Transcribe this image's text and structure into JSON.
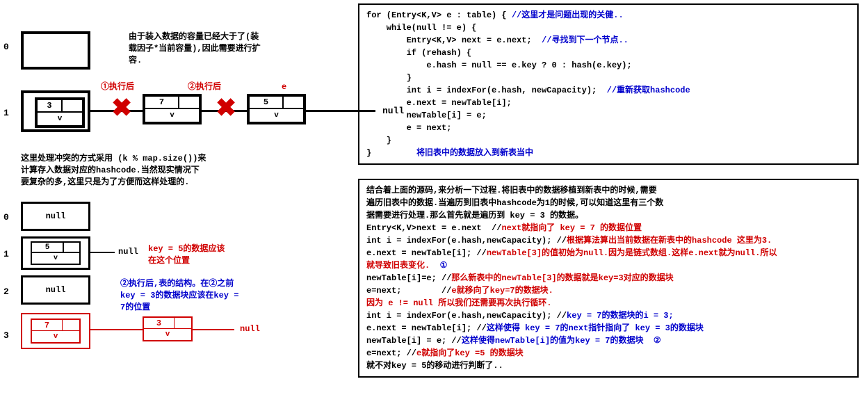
{
  "left": {
    "diagram1": {
      "idx0": "0",
      "idx1": "1",
      "intro": "由于装入数据的容量已经大于了(装\n载因子*当前容量),因此需要进行扩\n容.",
      "lbl_exec1": "①执行后",
      "lbl_exec2": "②执行后",
      "lbl_e": "e",
      "node1_k": "3",
      "node1_v": "v",
      "node2_k": "7",
      "node2_v": "v",
      "node3_k": "5",
      "node3_v": "v",
      "null1": "null",
      "hash_note": "这里处理冲突的方式采用 (k % map.size())来\n计算存入数据对应的hashcode.当然现实情况下\n要复杂的多,这里只是为了方便而这样处理的."
    },
    "diagram2": {
      "idx0": "0",
      "idx1": "1",
      "idx2": "2",
      "idx3": "3",
      "slot0": "null",
      "slot2": "null",
      "n1_k": "5",
      "n1_v": "v",
      "n3_k": "7",
      "n3_v": "v",
      "moved_k": "3",
      "moved_v": "v",
      "null_r1": "null",
      "null_r2": "null",
      "note_r1": "key = 5的数据应该\n在这个位置",
      "note_b": "②执行后,表的结构。在②之前\nkey = 3的数据块应该在key = \n7的位置"
    }
  },
  "code": {
    "l1a": "for (Entry<K,V> e : table) { ",
    "l1b": "//这里才是问题出现的关健..",
    "l2": "    while(null != e) {",
    "l3a": "        Entry<K,V> next = e.next;  ",
    "l3b": "//寻找到下一个节点..",
    "l4": "        if (rehash) {",
    "l5": "            e.hash = null == e.key ? 0 : hash(e.key);",
    "l6": "        }",
    "l7a": "        int i = indexFor(e.hash, newCapacity);  ",
    "l7b": "//重新获取hashcode",
    "l8": "        e.next = newTable[i];",
    "l9": "        newTable[i] = e;",
    "l10": "        e = next;",
    "l11": "    }",
    "l12a": "}         ",
    "l12b": "将旧表中的数据放入到新表当中"
  },
  "analysis": {
    "p1": "结合着上面的源码,来分析一下过程.将旧表中的数据移植到新表中的时候,需要\n遍历旧表中的数据.当遍历到旧表中hashcode为1的时候,可以知道这里有三个数\n据需要进行处理.那么首先就是遍历到 key = 3 的数据。",
    "l1": "Entry<K,V>next = e.next  //",
    "l1r": "next就指向了 key = 7 的数据位置",
    "l2": "int i = indexFor(e.hash,newCapacity); //",
    "l2r": "根据算法算出当前数据在新表中的hashcode 这里为3.",
    "l3a": "e.next = newTable[i]; //",
    "l3r": "newTable[3]的值初始为null.因为是链式数组.这样e.next就为null.所以",
    "l3b": "就导致旧表变化.  ",
    "circ1": "①",
    "l4a": "newTable[i]=e; //",
    "l4r": "那么新表中的newTable[3]的数据就是key=3对应的数据块",
    "l5a": "e=next;        //",
    "l5r": "e就移向了key=7的数据块.",
    "l6r": "因为 e != null 所以我们还需要再次执行循环.",
    "l7": "int i = indexFor(e.hash,newCapacity); //",
    "l7b": "key = 7的数据块的i = 3;",
    "l8a": "e.next = newTable[i]; //",
    "l8b": "这样使得 key = 7的next指针指向了 key = 3的数据块",
    "l9a": "newTable[i] = e; //",
    "l9b": "这样使得newTable[i]的值为key = 7的数据块  ",
    "circ2": "②",
    "l10a": "e=next; //",
    "l10r": "e就指向了key =5 的数据块",
    "l11": "就不对key = 5的移动进行判断了.."
  }
}
